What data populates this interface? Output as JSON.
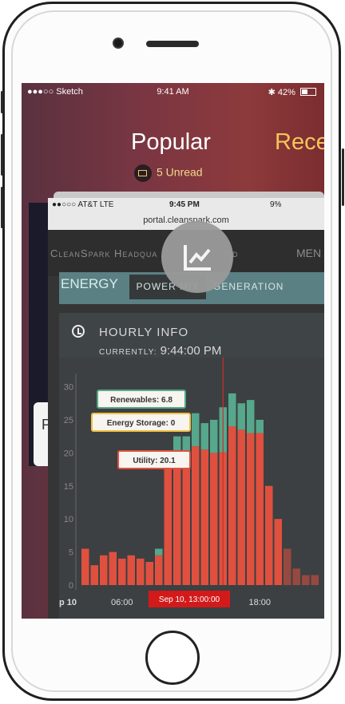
{
  "status_bar": {
    "carrier": "●●●○○ Sketch",
    "time": "9:41 AM",
    "battery": "42%"
  },
  "header": {
    "title": "Popular",
    "next_title": "Rece",
    "unread": "5 Unread"
  },
  "behind_card_letter": "P",
  "card": {
    "status": {
      "carrier": "●●○○○ AT&T  LTE",
      "time": "9:45 PM",
      "right": "9%"
    },
    "url": "portal.cleanspark.com",
    "brand": "CleanSpark Headqua",
    "brand_tail": "rid",
    "menu": "MEN",
    "tabs": {
      "energy": "ENERGY",
      "power_mix": "POWER MIX",
      "generation": "GENERATION"
    },
    "info": {
      "title": "HOURLY INFO",
      "current_label": "CURRENTLY:",
      "current_time": "9:44:00 PM"
    }
  },
  "colors": {
    "utility": "#e0503f",
    "renewables": "#56a78b",
    "storage": "#f0c040",
    "panel": "#3c4042",
    "tab_bar": "#5b8083"
  },
  "chart_data": {
    "type": "bar",
    "stacked": true,
    "x_tick_labels": [
      "p 10",
      "06:00",
      "18:00"
    ],
    "highlight_label": "Sep 10, 13:00:00",
    "ylim": [
      0,
      32
    ],
    "yticks": [
      0,
      5,
      10,
      15,
      20,
      25,
      30
    ],
    "series": [
      {
        "name": "Utility",
        "color": "#e0503f",
        "values": [
          5.5,
          3,
          4.5,
          5,
          4,
          4.5,
          4,
          3.5,
          4.5,
          19.5,
          19.5,
          19.5,
          21,
          20.5,
          20,
          20.1,
          24,
          23.5,
          23,
          23,
          15,
          10,
          5.5,
          2.5,
          1.5,
          1.5
        ]
      },
      {
        "name": "Renewables",
        "color": "#56a78b",
        "values": [
          0,
          0,
          0,
          0,
          0,
          0,
          0,
          0,
          1,
          0,
          3,
          3,
          5,
          4,
          5,
          6.8,
          5,
          4,
          5,
          2,
          0,
          0,
          0,
          0,
          0,
          0
        ]
      },
      {
        "name": "Energy Storage",
        "color": "#f0c040",
        "values": [
          0,
          0,
          0,
          0,
          0,
          0,
          0,
          0,
          0,
          0,
          0,
          0,
          0,
          0,
          0,
          0,
          0,
          0,
          0,
          0,
          0,
          0,
          0,
          0,
          0,
          0
        ]
      }
    ],
    "tooltips": [
      {
        "label": "Renewables: 6.8"
      },
      {
        "label": "Energy Storage: 0"
      },
      {
        "label": "Utility: 20.1"
      }
    ]
  }
}
